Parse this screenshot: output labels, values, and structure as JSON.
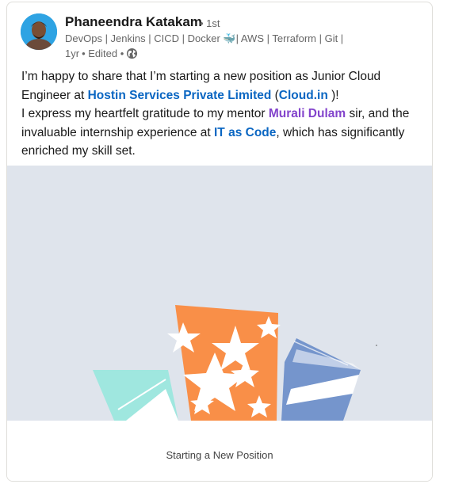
{
  "author": {
    "name": "Phaneendra Katakam",
    "degree": "• 1st",
    "headline": "DevOps | Jenkins | CICD | Docker 🐳| AWS | Terraform | Git |",
    "time": "1yr",
    "edited": "• Edited •",
    "visibility_icon": "globe-icon"
  },
  "post": {
    "t1": "I’m happy to share that I’m starting a new position as Junior Cloud Engineer at ",
    "company": "Hostin Services Private Limited",
    "t2": " (",
    "company_site": "Cloud.in",
    "t3": " )!",
    "t4": "I express my heartfelt gratitude to my mentor ",
    "mentor": "Murali Dulam",
    "t5": " sir, and the invaluable internship experience at ",
    "org": "IT as Code",
    "t6": ", which has significantly enriched my skill set."
  },
  "media": {
    "caption": "Starting a New Position",
    "colors": {
      "background": "#dfe4ec",
      "teal": "#9fe7df",
      "orange": "#f98f48",
      "blue": "#7595cc",
      "link": "#0a66c2",
      "mention": "#8344cc"
    }
  }
}
